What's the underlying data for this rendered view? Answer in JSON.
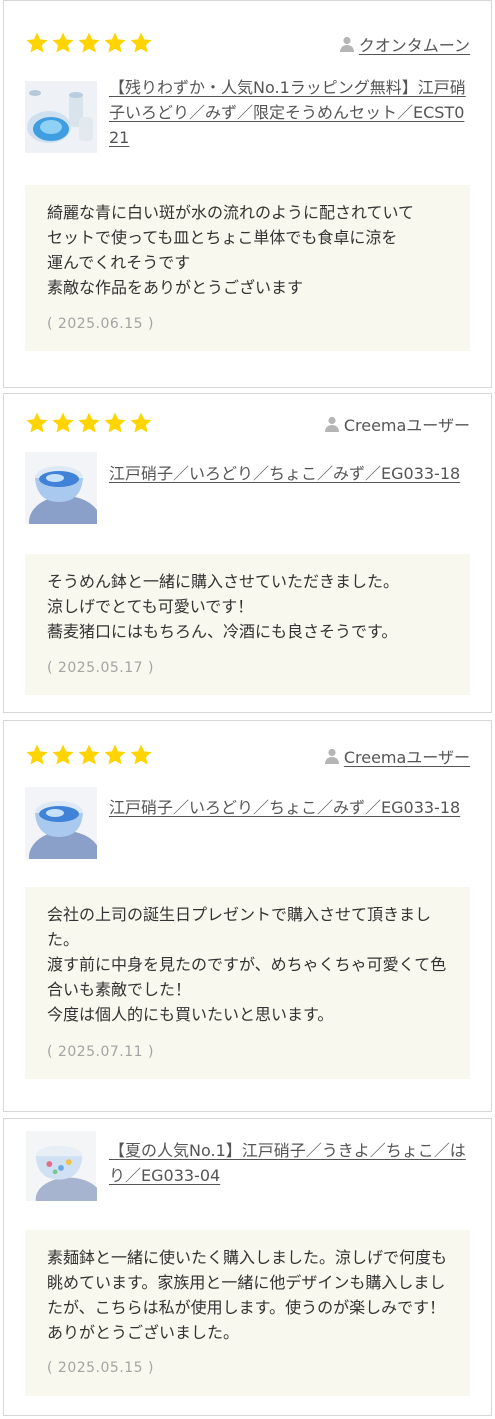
{
  "colors": {
    "star": "#ffd400",
    "review_bg": "#f9f8ef",
    "border": "#d7d7d7",
    "date": "#a3a3a3"
  },
  "reviews": [
    {
      "rating": 5,
      "user": "クオンタムーン",
      "product": "【残りわずか・人気No.1ラッピング無料】江戸硝子いろどり／みず／限定そうめんセット／ECST021",
      "text": "綺麗な青に白い斑が水の流れのように配されていて\nセットで使っても皿とちょこ単体でも食卓に涼を\n運んでくれそうです\n素敵な作品をありがとうございます",
      "date": "( 2025.06.15 )"
    },
    {
      "rating": 5,
      "user": "Creemaユーザー",
      "product": "江戸硝子／いろどり／ちょこ／みず／EG033-18",
      "text": "そうめん鉢と一緒に購入させていただきました。\n涼しげでとても可愛いです！\n蕎麦猪口にはもちろん、冷酒にも良さそうです。",
      "date": "( 2025.05.17 )"
    },
    {
      "rating": 5,
      "user": "Creemaユーザー",
      "product": "江戸硝子／いろどり／ちょこ／みず／EG033-18",
      "text": "会社の上司の誕生日プレゼントで購入させて頂きました。\n渡す前に中身を見たのですが、めちゃくちゃ可愛くて色合いも素敵でした！\n今度は個人的にも買いたいと思います。",
      "date": "( 2025.07.11 )"
    },
    {
      "product": "【夏の人気No.1】江戸硝子／うきよ／ちょこ／はり／EG033-04",
      "text": "素麺鉢と一緒に使いたく購入しました。涼しげで何度も眺めています。家族用と一緒に他デザインも購入しましたが、こちらは私が使用します。使うのが楽しみです！ありがとうございました。",
      "date": "( 2025.05.15 )"
    }
  ]
}
